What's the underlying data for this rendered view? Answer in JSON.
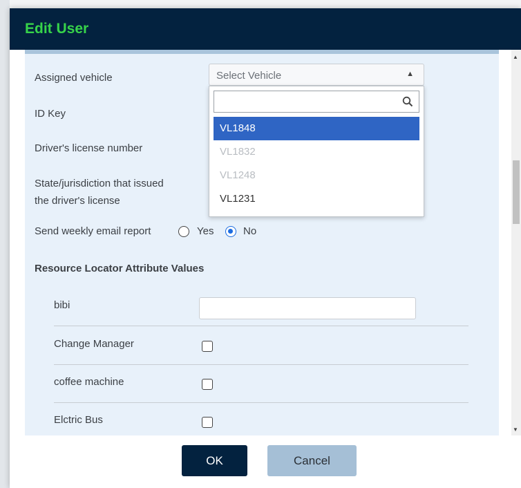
{
  "modal": {
    "title": "Edit User"
  },
  "form": {
    "assigned_vehicle_label": "Assigned vehicle",
    "select_placeholder": "Select Vehicle",
    "id_key_label": "ID Key",
    "license_label": "Driver's license number",
    "state_label_line1": "State/jurisdiction that issued",
    "state_label_line2": "the driver's license",
    "weekly_report_label": "Send weekly email report",
    "radio_yes": "Yes",
    "radio_no": "No",
    "weekly_report_value": "No"
  },
  "dropdown": {
    "search_value": "",
    "options": [
      {
        "label": "VL1848",
        "state": "selected"
      },
      {
        "label": "VL1832",
        "state": "disabled"
      },
      {
        "label": "VL1248",
        "state": "disabled"
      },
      {
        "label": "VL1231",
        "state": "normal"
      }
    ]
  },
  "attributes": {
    "section_title": "Resource Locator Attribute Values",
    "rows": [
      {
        "label": "bibi",
        "type": "text",
        "value": ""
      },
      {
        "label": "Change Manager",
        "type": "checkbox",
        "checked": false
      },
      {
        "label": "coffee machine",
        "type": "checkbox",
        "checked": false
      },
      {
        "label": "Elctric Bus",
        "type": "checkbox",
        "checked": false
      }
    ]
  },
  "footer": {
    "ok_label": "OK",
    "cancel_label": "Cancel"
  },
  "colors": {
    "header_bg": "#03223f",
    "title": "#37d34a",
    "accent": "#2f65c4",
    "content_bg": "#e8f1fa"
  },
  "icons": {
    "search": "search-icon",
    "dropdown_arrow": "chevron-up-icon"
  }
}
